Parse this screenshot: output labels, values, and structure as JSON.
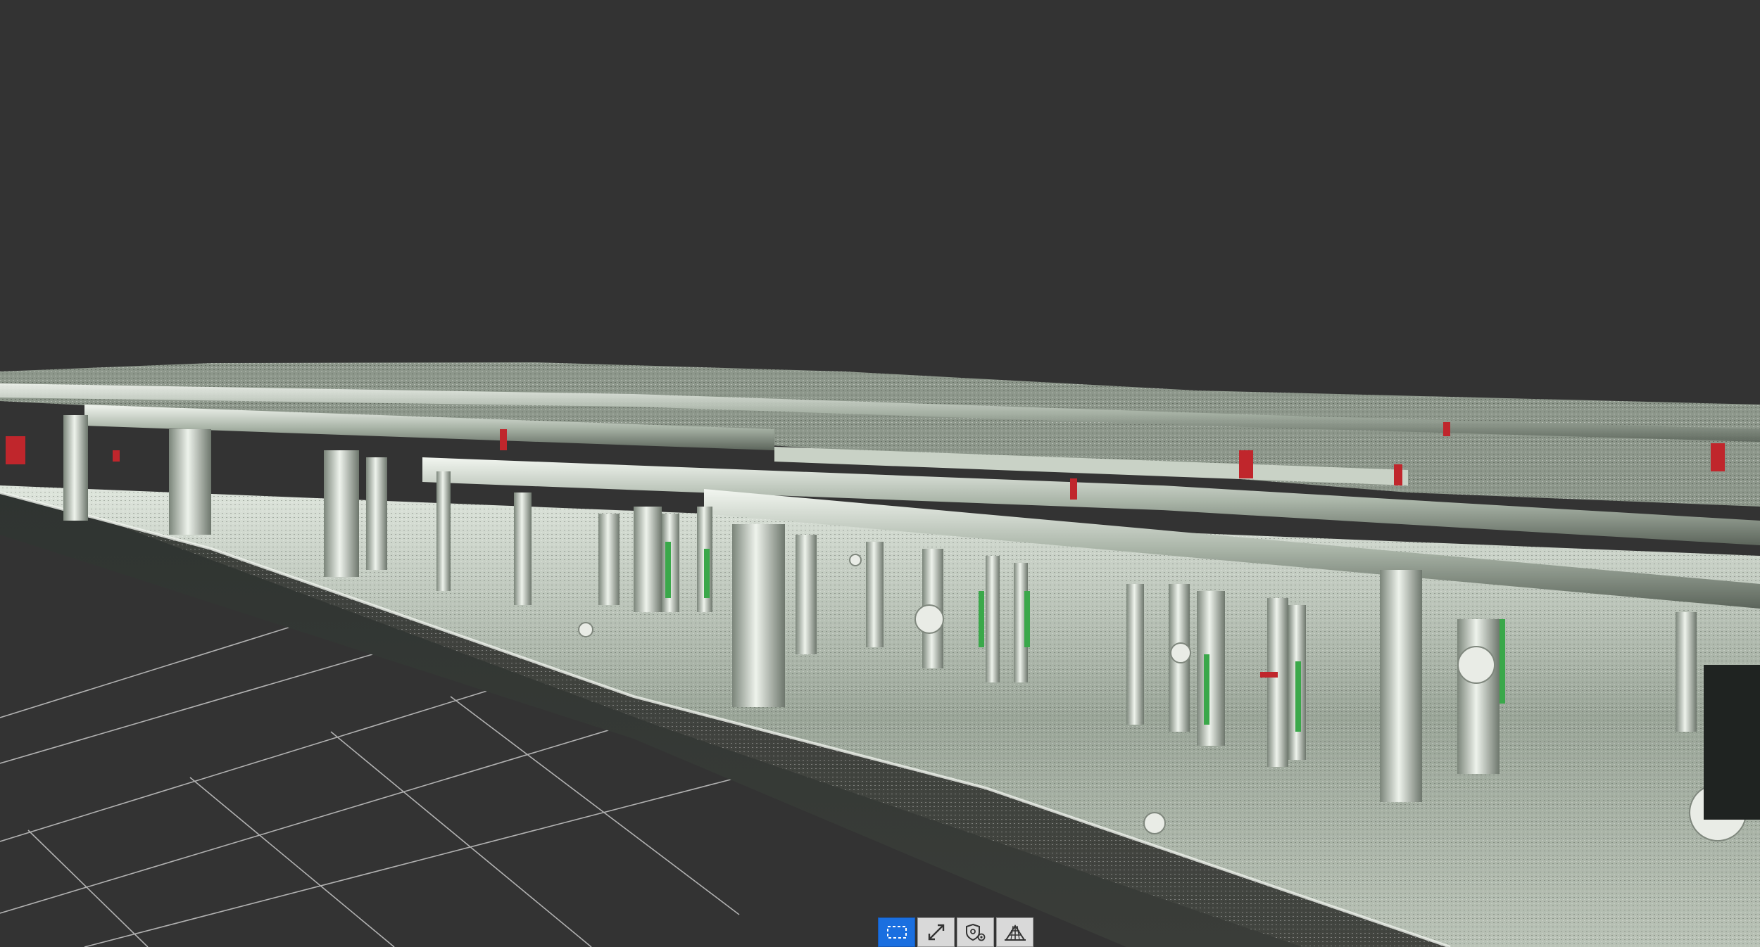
{
  "app": {
    "view": "3d-point-cloud-viewport"
  },
  "colors": {
    "background": "#333333",
    "grid": "#c8c8c8",
    "active_tool": "#1a6fe0",
    "tool_bg": "#d9d9d9",
    "pipe_light": "#e8efe6",
    "pipe_mid": "#9aa79a",
    "pipe_dark": "#4a524a",
    "red_valve": "#c0262c",
    "green_label": "#3aa84a"
  },
  "toolbar": {
    "items": [
      {
        "name": "box-select-tool",
        "icon": "dashed-rectangle-icon",
        "active": true
      },
      {
        "name": "measure-tool",
        "icon": "diagonal-arrow-icon",
        "active": false
      },
      {
        "name": "clip-tool",
        "icon": "shield-gear-icon",
        "active": false
      },
      {
        "name": "view-mode-tool",
        "icon": "perspective-grid-icon",
        "active": false
      }
    ]
  }
}
